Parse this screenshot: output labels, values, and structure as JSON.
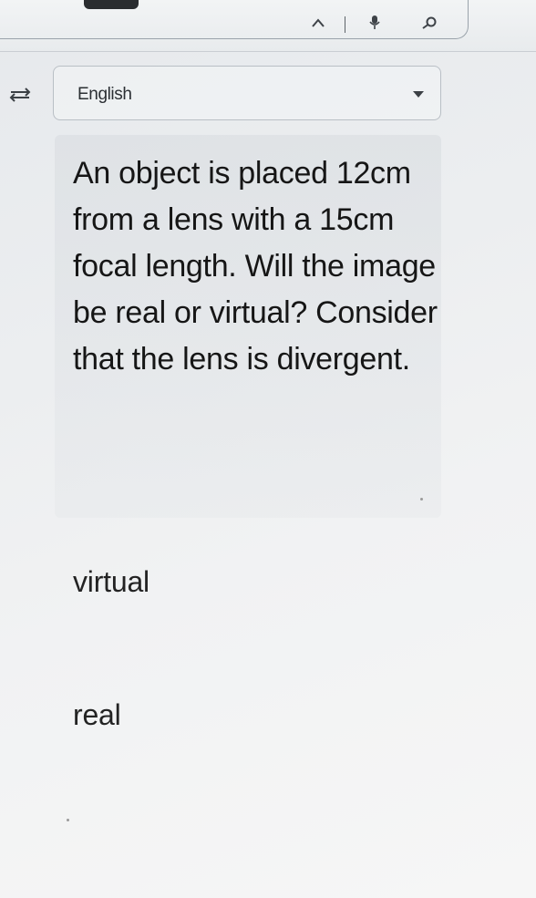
{
  "language_selector": {
    "label": "English",
    "icon": "chevron-down-icon"
  },
  "toolbar": {
    "icons": [
      "chevron-up-icon",
      "microphone-icon",
      "search-icon",
      "swap-languages-icon"
    ]
  },
  "question": {
    "text": "An object is placed 12cm from a lens with a 15cm focal length. Will the image be real or virtual? Consider that the lens is divergent."
  },
  "options": [
    {
      "label": "virtual"
    },
    {
      "label": "real"
    }
  ],
  "colors": {
    "background": "#eceef0",
    "text": "#161616",
    "border": "#b9bfc5"
  }
}
